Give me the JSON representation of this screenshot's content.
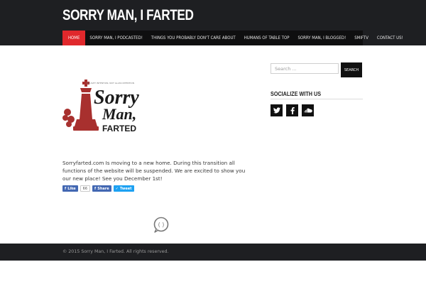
{
  "site": {
    "title": "SORRY MAN, I FARTED"
  },
  "nav": {
    "items": [
      {
        "label": "HOME",
        "active": true
      },
      {
        "label": "SORRY MAN, I PODCASTED!"
      },
      {
        "label": "THINGS YOU PROBABLY DON'T CARE ABOUT"
      },
      {
        "label": "HUMANS OF TABLE TOP"
      },
      {
        "label": "SORRY MAN, I BLOGGED!"
      },
      {
        "label": "SMIFTV"
      },
      {
        "label": "CONTACT US!"
      }
    ]
  },
  "logo": {
    "tagline": "BOUGHT INTENTION, NOT GLASS INTENTION",
    "line1": "Sorry",
    "line2": "Man,",
    "line3": "FARTED",
    "initial": "I"
  },
  "post": {
    "text": "Sorryfarted.com  Is moving to a new home.  During this transition all functions of the website will be suspended.  We are excited to show you our new place!  See you December 1st!"
  },
  "share": {
    "like_label": "Like",
    "like_count": "66",
    "share_label": "Share",
    "tweet_label": "Tweet"
  },
  "search": {
    "placeholder": "Search ...",
    "button_label": "SEARCH"
  },
  "widget": {
    "title": "SOCIALIZE WITH US"
  },
  "social_icons": [
    "twitter-icon",
    "facebook-icon",
    "soundcloud-icon"
  ],
  "footer": {
    "text": "© 2015 Sorry Man, I Farted. All rights reserved."
  },
  "colors": {
    "accent": "#e0282c",
    "header_bg": "#1e1f22",
    "nav_bg": "#0f0f10",
    "logo_red": "#a8302e"
  }
}
